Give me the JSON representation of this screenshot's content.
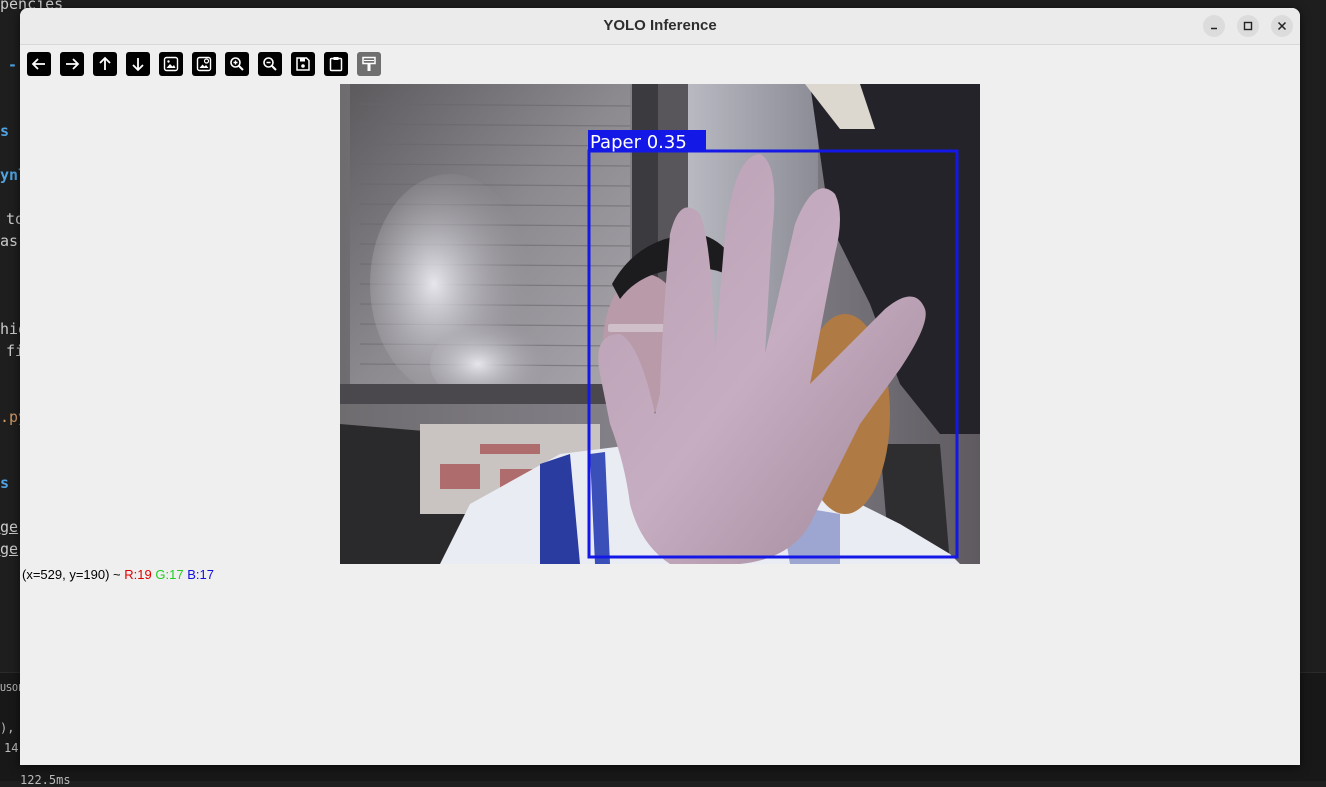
{
  "window": {
    "title": "YOLO Inference"
  },
  "toolbar": {
    "buttons": [
      {
        "name": "pan-left-button",
        "icon": "arrow-left-icon"
      },
      {
        "name": "pan-right-button",
        "icon": "arrow-right-icon"
      },
      {
        "name": "pan-up-button",
        "icon": "arrow-up-icon"
      },
      {
        "name": "pan-down-button",
        "icon": "arrow-down-icon"
      },
      {
        "name": "zoom-original-button",
        "icon": "image-icon"
      },
      {
        "name": "zoom-fit-button",
        "icon": "image-fit-icon"
      },
      {
        "name": "zoom-in-button",
        "icon": "zoom-in-icon"
      },
      {
        "name": "zoom-out-button",
        "icon": "zoom-out-icon"
      },
      {
        "name": "save-button",
        "icon": "save-icon"
      },
      {
        "name": "copy-clipboard-button",
        "icon": "clipboard-icon"
      },
      {
        "name": "properties-button",
        "icon": "paint-icon"
      }
    ]
  },
  "detection": {
    "label": "Paper 0.35",
    "box_color": "#1418e6"
  },
  "status": {
    "coords": "(x=529, y=190) ~",
    "r": "R:19",
    "g": "G:17",
    "b": "B:17"
  },
  "background_editor": {
    "lines": [
      "pencies",
      "- t",
      "s",
      "ynl",
      "to",
      "as",
      "hio",
      "fi",
      ".py",
      "s",
      "ge",
      "ge"
    ],
    "terminal": [
      "USOL",
      "),",
      "14",
      "122.5ms"
    ]
  },
  "colors": {
    "window_bg": "#efefef",
    "accent_blue": "#1418e6"
  }
}
